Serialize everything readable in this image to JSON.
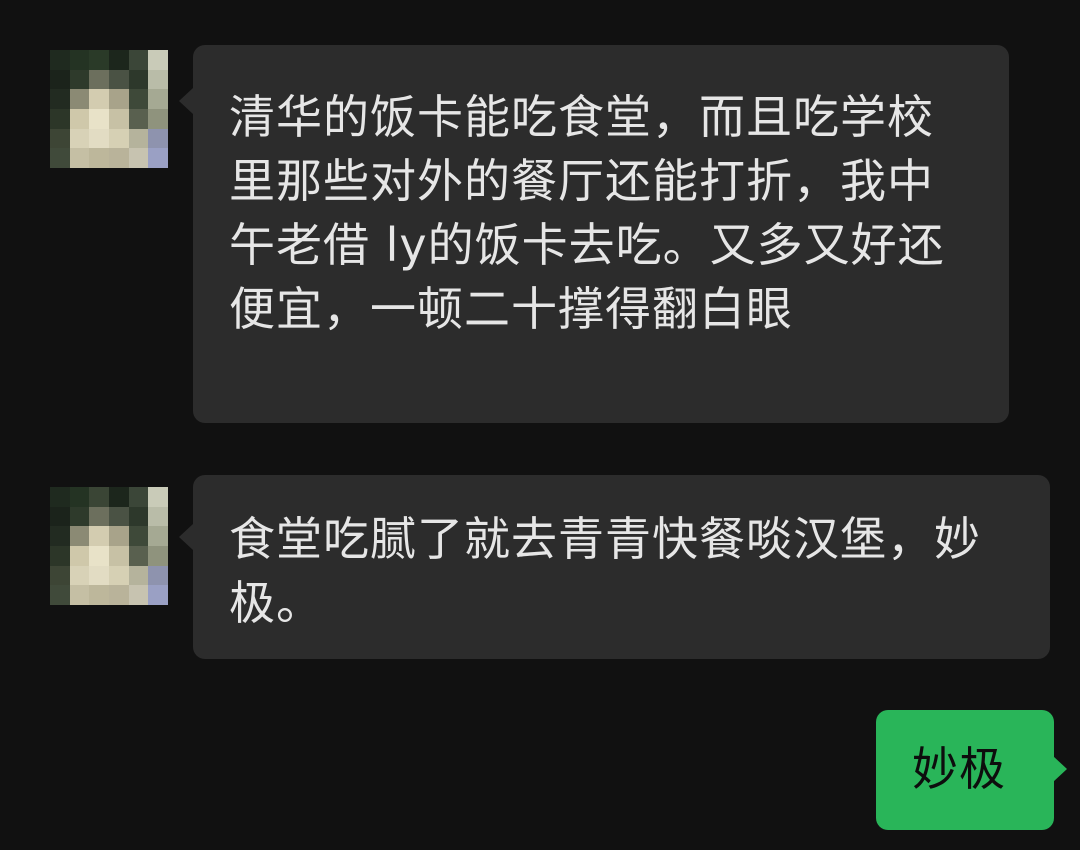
{
  "chat": {
    "messages": [
      {
        "sender": "contact",
        "text": "清华的饭卡能吃食堂，而且吃学校里那些对外的餐厅还能打折，我中午老借 ly的饭卡去吃。又多又好还便宜，一顿二十撑得翻白眼"
      },
      {
        "sender": "contact",
        "text": "食堂吃腻了就去青青快餐啖汉堡，妙极。"
      },
      {
        "sender": "self",
        "text": "妙极"
      }
    ],
    "avatar_icon": "pixelated-avatar-icon",
    "colors": {
      "background": "#111111",
      "incoming_bubble": "#2c2c2c",
      "outgoing_bubble": "#29b559",
      "incoming_text": "#e6e6e6",
      "outgoing_text": "#0d0d0d"
    }
  }
}
